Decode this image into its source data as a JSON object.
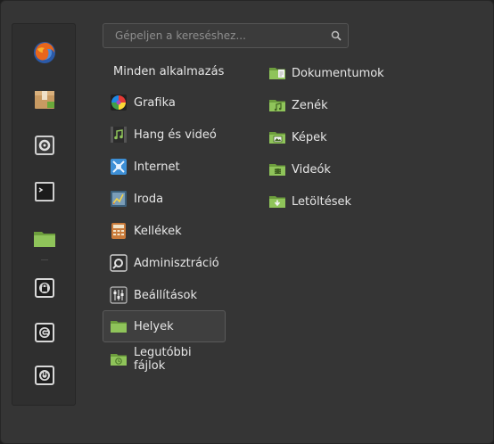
{
  "search": {
    "placeholder": "Gépeljen a kereséshez..."
  },
  "favorites": [
    {
      "name": "firefox-icon"
    },
    {
      "name": "software-manager-icon"
    },
    {
      "name": "system-settings-icon"
    },
    {
      "name": "terminal-icon"
    },
    {
      "name": "files-folder-icon"
    },
    {
      "name": "lock-screen-icon"
    },
    {
      "name": "logout-icon"
    },
    {
      "name": "shutdown-icon"
    }
  ],
  "categories": {
    "all": "Minden alkalmazás",
    "items": [
      {
        "label": "Grafika",
        "icon": "graphics-icon"
      },
      {
        "label": "Hang és videó",
        "icon": "multimedia-icon"
      },
      {
        "label": "Internet",
        "icon": "internet-icon"
      },
      {
        "label": "Iroda",
        "icon": "office-icon"
      },
      {
        "label": "Kellékek",
        "icon": "accessories-icon"
      },
      {
        "label": "Adminisztráció",
        "icon": "administration-icon"
      },
      {
        "label": "Beállítások",
        "icon": "settings-icon"
      },
      {
        "label": "Helyek",
        "icon": "places-folder-icon",
        "selected": true
      },
      {
        "label": "Legutóbbi fájlok",
        "icon": "recent-files-icon"
      }
    ]
  },
  "places": [
    {
      "label": "Dokumentumok",
      "icon": "documents-folder-icon"
    },
    {
      "label": "Zenék",
      "icon": "music-folder-icon"
    },
    {
      "label": "Képek",
      "icon": "pictures-folder-icon"
    },
    {
      "label": "Videók",
      "icon": "videos-folder-icon"
    },
    {
      "label": "Letöltések",
      "icon": "downloads-folder-icon"
    }
  ],
  "colors": {
    "folder_green": "#8fc45a",
    "folder_dark": "#6d9e3d",
    "panel": "#353535"
  }
}
